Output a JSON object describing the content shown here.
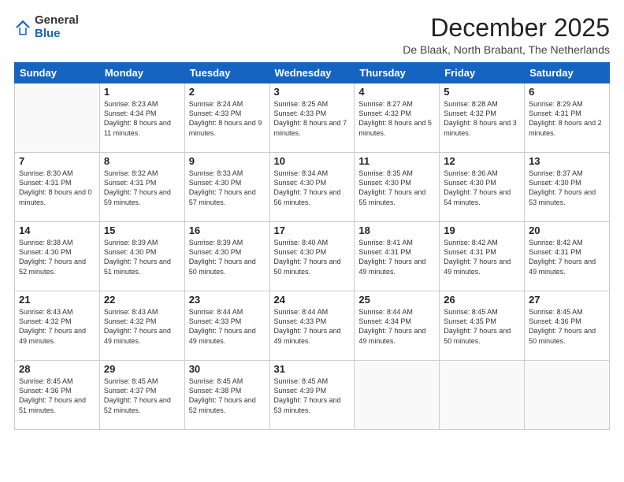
{
  "header": {
    "logo_general": "General",
    "logo_blue": "Blue",
    "month_title": "December 2025",
    "location": "De Blaak, North Brabant, The Netherlands"
  },
  "days_of_week": [
    "Sunday",
    "Monday",
    "Tuesday",
    "Wednesday",
    "Thursday",
    "Friday",
    "Saturday"
  ],
  "weeks": [
    [
      {
        "day": "",
        "sunrise": "",
        "sunset": "",
        "daylight": ""
      },
      {
        "day": "1",
        "sunrise": "Sunrise: 8:23 AM",
        "sunset": "Sunset: 4:34 PM",
        "daylight": "Daylight: 8 hours and 11 minutes."
      },
      {
        "day": "2",
        "sunrise": "Sunrise: 8:24 AM",
        "sunset": "Sunset: 4:33 PM",
        "daylight": "Daylight: 8 hours and 9 minutes."
      },
      {
        "day": "3",
        "sunrise": "Sunrise: 8:25 AM",
        "sunset": "Sunset: 4:33 PM",
        "daylight": "Daylight: 8 hours and 7 minutes."
      },
      {
        "day": "4",
        "sunrise": "Sunrise: 8:27 AM",
        "sunset": "Sunset: 4:32 PM",
        "daylight": "Daylight: 8 hours and 5 minutes."
      },
      {
        "day": "5",
        "sunrise": "Sunrise: 8:28 AM",
        "sunset": "Sunset: 4:32 PM",
        "daylight": "Daylight: 8 hours and 3 minutes."
      },
      {
        "day": "6",
        "sunrise": "Sunrise: 8:29 AM",
        "sunset": "Sunset: 4:31 PM",
        "daylight": "Daylight: 8 hours and 2 minutes."
      }
    ],
    [
      {
        "day": "7",
        "sunrise": "Sunrise: 8:30 AM",
        "sunset": "Sunset: 4:31 PM",
        "daylight": "Daylight: 8 hours and 0 minutes."
      },
      {
        "day": "8",
        "sunrise": "Sunrise: 8:32 AM",
        "sunset": "Sunset: 4:31 PM",
        "daylight": "Daylight: 7 hours and 59 minutes."
      },
      {
        "day": "9",
        "sunrise": "Sunrise: 8:33 AM",
        "sunset": "Sunset: 4:30 PM",
        "daylight": "Daylight: 7 hours and 57 minutes."
      },
      {
        "day": "10",
        "sunrise": "Sunrise: 8:34 AM",
        "sunset": "Sunset: 4:30 PM",
        "daylight": "Daylight: 7 hours and 56 minutes."
      },
      {
        "day": "11",
        "sunrise": "Sunrise: 8:35 AM",
        "sunset": "Sunset: 4:30 PM",
        "daylight": "Daylight: 7 hours and 55 minutes."
      },
      {
        "day": "12",
        "sunrise": "Sunrise: 8:36 AM",
        "sunset": "Sunset: 4:30 PM",
        "daylight": "Daylight: 7 hours and 54 minutes."
      },
      {
        "day": "13",
        "sunrise": "Sunrise: 8:37 AM",
        "sunset": "Sunset: 4:30 PM",
        "daylight": "Daylight: 7 hours and 53 minutes."
      }
    ],
    [
      {
        "day": "14",
        "sunrise": "Sunrise: 8:38 AM",
        "sunset": "Sunset: 4:30 PM",
        "daylight": "Daylight: 7 hours and 52 minutes."
      },
      {
        "day": "15",
        "sunrise": "Sunrise: 8:39 AM",
        "sunset": "Sunset: 4:30 PM",
        "daylight": "Daylight: 7 hours and 51 minutes."
      },
      {
        "day": "16",
        "sunrise": "Sunrise: 8:39 AM",
        "sunset": "Sunset: 4:30 PM",
        "daylight": "Daylight: 7 hours and 50 minutes."
      },
      {
        "day": "17",
        "sunrise": "Sunrise: 8:40 AM",
        "sunset": "Sunset: 4:30 PM",
        "daylight": "Daylight: 7 hours and 50 minutes."
      },
      {
        "day": "18",
        "sunrise": "Sunrise: 8:41 AM",
        "sunset": "Sunset: 4:31 PM",
        "daylight": "Daylight: 7 hours and 49 minutes."
      },
      {
        "day": "19",
        "sunrise": "Sunrise: 8:42 AM",
        "sunset": "Sunset: 4:31 PM",
        "daylight": "Daylight: 7 hours and 49 minutes."
      },
      {
        "day": "20",
        "sunrise": "Sunrise: 8:42 AM",
        "sunset": "Sunset: 4:31 PM",
        "daylight": "Daylight: 7 hours and 49 minutes."
      }
    ],
    [
      {
        "day": "21",
        "sunrise": "Sunrise: 8:43 AM",
        "sunset": "Sunset: 4:32 PM",
        "daylight": "Daylight: 7 hours and 49 minutes."
      },
      {
        "day": "22",
        "sunrise": "Sunrise: 8:43 AM",
        "sunset": "Sunset: 4:32 PM",
        "daylight": "Daylight: 7 hours and 49 minutes."
      },
      {
        "day": "23",
        "sunrise": "Sunrise: 8:44 AM",
        "sunset": "Sunset: 4:33 PM",
        "daylight": "Daylight: 7 hours and 49 minutes."
      },
      {
        "day": "24",
        "sunrise": "Sunrise: 8:44 AM",
        "sunset": "Sunset: 4:33 PM",
        "daylight": "Daylight: 7 hours and 49 minutes."
      },
      {
        "day": "25",
        "sunrise": "Sunrise: 8:44 AM",
        "sunset": "Sunset: 4:34 PM",
        "daylight": "Daylight: 7 hours and 49 minutes."
      },
      {
        "day": "26",
        "sunrise": "Sunrise: 8:45 AM",
        "sunset": "Sunset: 4:35 PM",
        "daylight": "Daylight: 7 hours and 50 minutes."
      },
      {
        "day": "27",
        "sunrise": "Sunrise: 8:45 AM",
        "sunset": "Sunset: 4:36 PM",
        "daylight": "Daylight: 7 hours and 50 minutes."
      }
    ],
    [
      {
        "day": "28",
        "sunrise": "Sunrise: 8:45 AM",
        "sunset": "Sunset: 4:36 PM",
        "daylight": "Daylight: 7 hours and 51 minutes."
      },
      {
        "day": "29",
        "sunrise": "Sunrise: 8:45 AM",
        "sunset": "Sunset: 4:37 PM",
        "daylight": "Daylight: 7 hours and 52 minutes."
      },
      {
        "day": "30",
        "sunrise": "Sunrise: 8:45 AM",
        "sunset": "Sunset: 4:38 PM",
        "daylight": "Daylight: 7 hours and 52 minutes."
      },
      {
        "day": "31",
        "sunrise": "Sunrise: 8:45 AM",
        "sunset": "Sunset: 4:39 PM",
        "daylight": "Daylight: 7 hours and 53 minutes."
      },
      {
        "day": "",
        "sunrise": "",
        "sunset": "",
        "daylight": ""
      },
      {
        "day": "",
        "sunrise": "",
        "sunset": "",
        "daylight": ""
      },
      {
        "day": "",
        "sunrise": "",
        "sunset": "",
        "daylight": ""
      }
    ]
  ]
}
